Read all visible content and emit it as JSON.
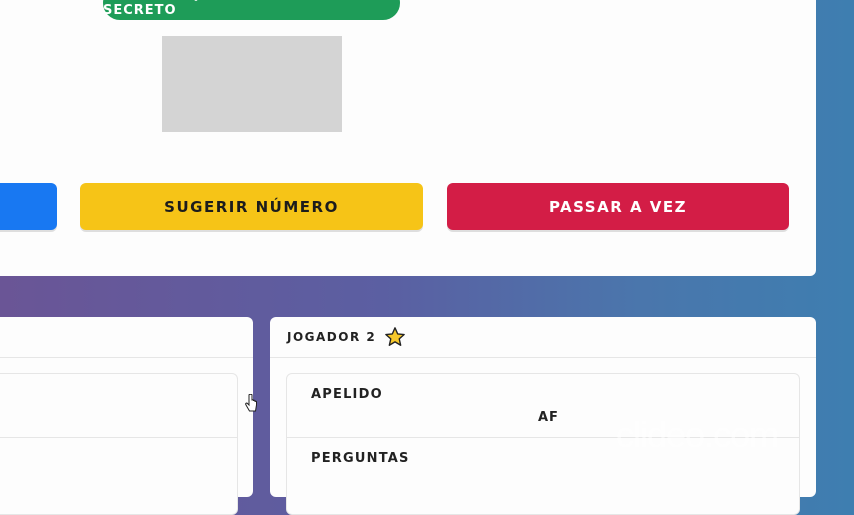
{
  "badge": {
    "label": "ADIVINHE QUAL O NÚMERO SECRETO"
  },
  "actions": {
    "suggest_label": "SUGERIR NÚMERO",
    "pass_label": "PASSAR A VEZ"
  },
  "colors": {
    "badge": "#1e9c58",
    "blue_button": "#1878f2",
    "yellow_button": "#f6c417",
    "red_button": "#d31d46"
  },
  "player2": {
    "title": "JOGADOR 2",
    "star_icon": "star-icon",
    "nickname_label": "APELIDO",
    "nickname_value": "AF",
    "questions_label": "PERGUNTAS"
  },
  "watermark": "clideo.com"
}
